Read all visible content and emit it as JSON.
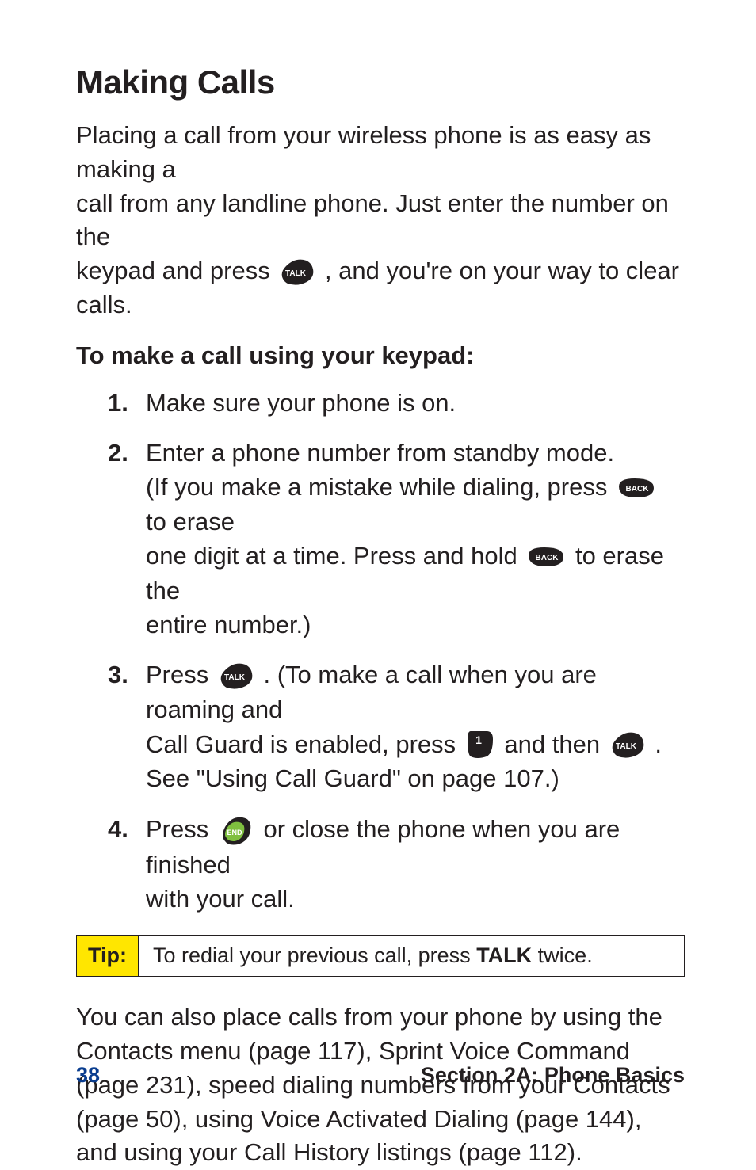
{
  "heading": "Making Calls",
  "intro": {
    "line1": "Placing a call from your wireless phone is as easy as making a",
    "line2": "call from any landline phone. Just enter the number on the",
    "line3a": "keypad and press ",
    "line3b": " , and you're on your way to clear calls."
  },
  "subhead": "To make a call using your keypad:",
  "steps": {
    "s1": {
      "num": "1.",
      "text": "Make sure your phone is on."
    },
    "s2": {
      "num": "2.",
      "l1": "Enter a phone number from standby mode.",
      "l2a": "(If you make a mistake while dialing, press ",
      "l2b": " to erase",
      "l3a": "one digit at a time. Press and hold ",
      "l3b": " to erase the",
      "l4": "entire number.)"
    },
    "s3": {
      "num": "3.",
      "l1a": "Press ",
      "l1b": " . (To make a call when you are roaming and",
      "l2a": "Call Guard is enabled, press ",
      "l2b": " and then ",
      "l2c": " .",
      "l3": "See \"Using Call Guard\" on page 107.)"
    },
    "s4": {
      "num": "4.",
      "l1a": "Press ",
      "l1b": " or close the phone when you are finished",
      "l2": "with your call."
    }
  },
  "tip": {
    "label": "Tip:",
    "text_before": "To redial your previous call, press ",
    "bold": "TALK",
    "text_after": " twice."
  },
  "outro": "You can also place calls from your phone by using the Contacts menu (page 117), Sprint Voice Command (page 231), speed dialing numbers from your Contacts (page 50), using Voice Activated Dialing (page 144), and using your Call History listings (page 112).",
  "footer": {
    "page": "38",
    "section": "Section 2A: Phone Basics"
  },
  "icons": {
    "talk": "talk-key-icon",
    "back": "back-key-icon",
    "one": "one-key-icon",
    "end": "end-key-icon"
  }
}
